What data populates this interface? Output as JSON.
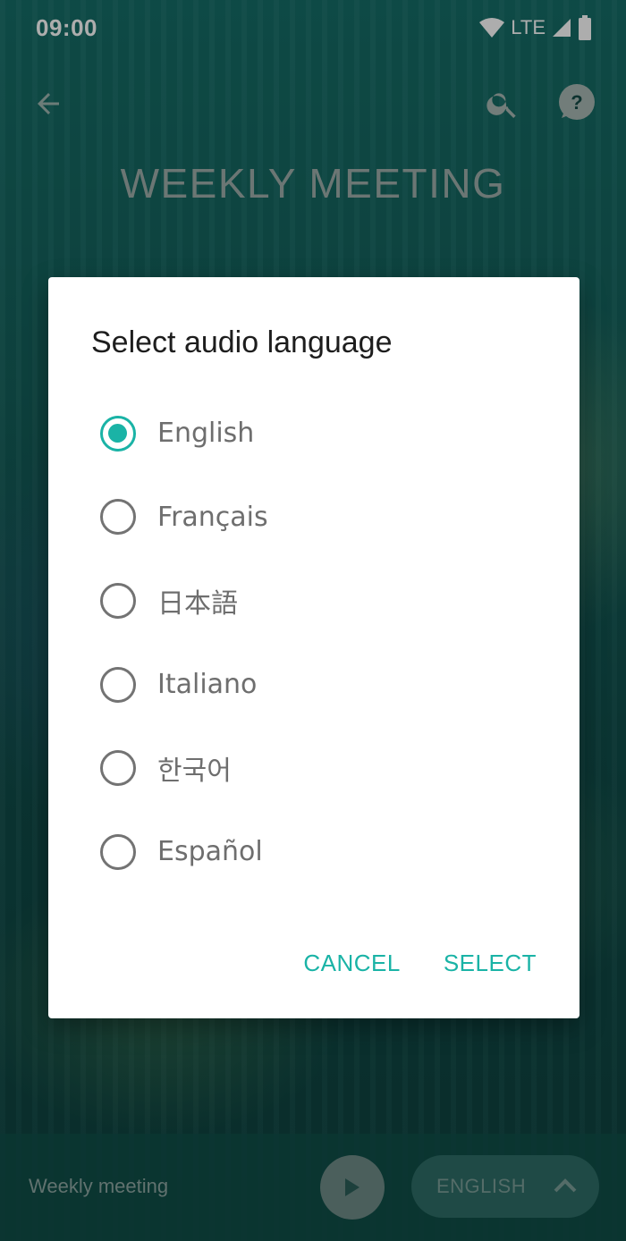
{
  "status_bar": {
    "time": "09:00",
    "network": "LTE"
  },
  "app_bar": {
    "title": "WEEKLY MEETING"
  },
  "dialog": {
    "title": "Select audio language",
    "options": [
      {
        "label": "English",
        "selected": true
      },
      {
        "label": "Français",
        "selected": false
      },
      {
        "label": "日本語",
        "selected": false
      },
      {
        "label": "Italiano",
        "selected": false
      },
      {
        "label": "한국어",
        "selected": false
      },
      {
        "label": "Español",
        "selected": false
      }
    ],
    "cancel_label": "CANCEL",
    "select_label": "SELECT"
  },
  "player": {
    "title": "Weekly meeting",
    "language": "ENGLISH"
  },
  "colors": {
    "accent": "#1ab3a6",
    "radio_off": "#737373"
  },
  "icons": [
    "back-arrow-icon",
    "search-icon",
    "help-icon",
    "play-icon",
    "chevron-up-icon",
    "wifi-icon",
    "signal-icon",
    "battery-icon"
  ]
}
